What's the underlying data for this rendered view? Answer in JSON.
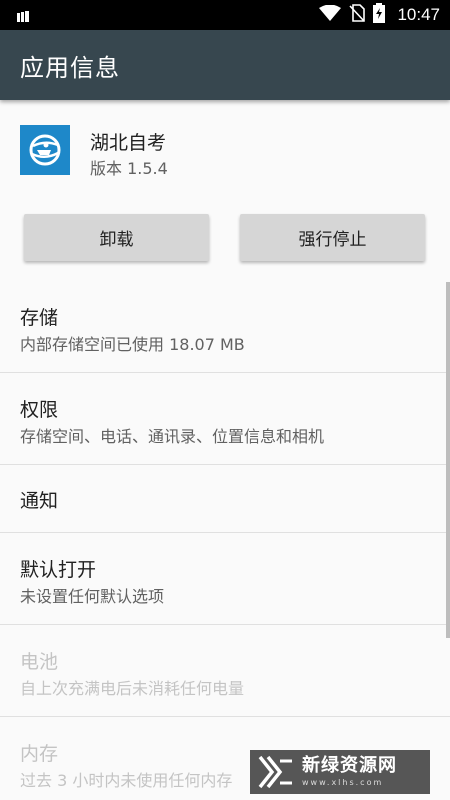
{
  "status_bar": {
    "time": "10:47"
  },
  "app_bar": {
    "title": "应用信息"
  },
  "app": {
    "name": "湖北自考",
    "version": "版本 1.5.4"
  },
  "buttons": {
    "uninstall": "卸载",
    "force_stop": "强行停止"
  },
  "settings": [
    {
      "title": "存储",
      "subtitle": "内部存储空间已使用 18.07 MB",
      "enabled": true
    },
    {
      "title": "权限",
      "subtitle": "存储空间、电话、通讯录、位置信息和相机",
      "enabled": true
    },
    {
      "title": "通知",
      "subtitle": "",
      "enabled": true
    },
    {
      "title": "默认打开",
      "subtitle": "未设置任何默认选项",
      "enabled": true
    },
    {
      "title": "电池",
      "subtitle": "自上次充满电后未消耗任何电量",
      "enabled": false
    },
    {
      "title": "内存",
      "subtitle": "过去 3 小时内未使用任何内存",
      "enabled": false
    }
  ],
  "watermark": {
    "name": "新绿资源网",
    "url": "www.xlhs.com"
  },
  "colors": {
    "app_bar": "#37474f",
    "status_bar": "#000000",
    "app_icon": "#1e88c9",
    "background": "#fafafa"
  }
}
